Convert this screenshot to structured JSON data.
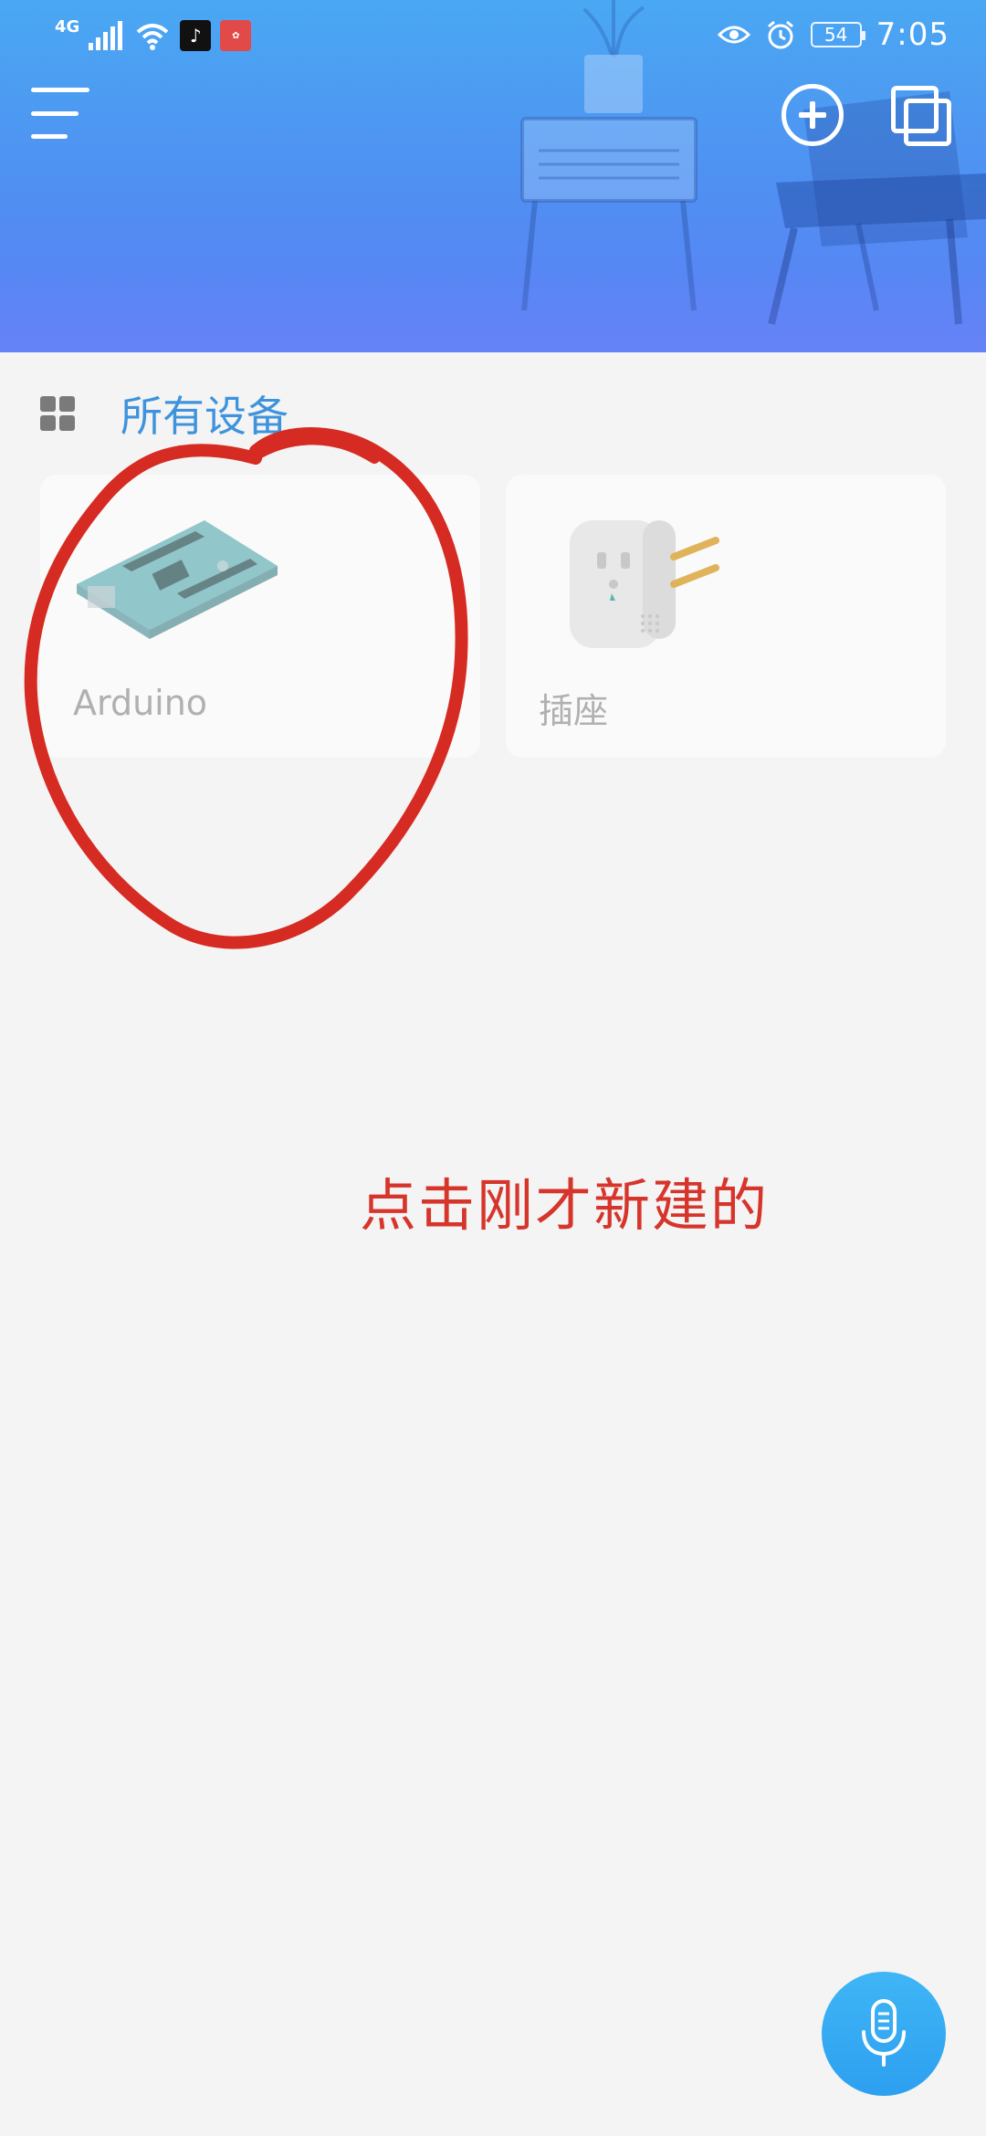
{
  "status_bar": {
    "network": "4G",
    "tiktok_icon": "tiktok-icon",
    "huawei_icon": "huawei-icon",
    "battery": "54",
    "time": "7:05"
  },
  "toolbar": {
    "menu_icon": "menu-icon",
    "add_icon": "plus-circle-icon",
    "scene_icon": "copy-icon"
  },
  "section": {
    "icon": "grid-icon",
    "title": "所有设备"
  },
  "devices": [
    {
      "label": "Arduino",
      "icon": "arduino-board-icon"
    },
    {
      "label": "插座",
      "icon": "socket-plug-icon"
    }
  ],
  "annotation": {
    "text": "点击刚才新建的",
    "color": "#d6352b"
  },
  "voice_button": {
    "icon": "microphone-icon"
  },
  "colors": {
    "header_top": "#4aa8f3",
    "header_bottom": "#5f7ff5",
    "accent": "#3f93dc",
    "background": "#f4f4f4"
  }
}
